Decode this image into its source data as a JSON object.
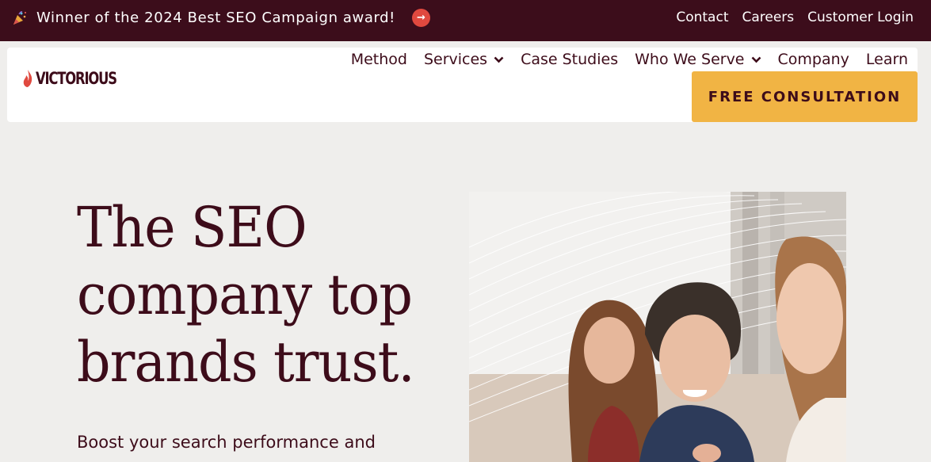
{
  "topbar": {
    "announcement": "Winner of the 2024 Best SEO Campaign award!",
    "links": [
      "Contact",
      "Careers",
      "Customer Login"
    ]
  },
  "header": {
    "logo_text": "VICTORIOUS",
    "nav": [
      {
        "label": "Method",
        "dropdown": false
      },
      {
        "label": "Services",
        "dropdown": true
      },
      {
        "label": "Case Studies",
        "dropdown": false
      },
      {
        "label": "Who We Serve",
        "dropdown": true
      },
      {
        "label": "Company",
        "dropdown": false
      },
      {
        "label": "Learn",
        "dropdown": false
      }
    ],
    "cta": "FREE CONSULTATION"
  },
  "hero": {
    "title_lines": [
      "The SEO",
      "company top",
      "brands trust."
    ],
    "subtitle": "Boost your search performance and"
  },
  "colors": {
    "topbar_bg": "#3c0d1b",
    "brand_text": "#3d0c1a",
    "cta_bg": "#f1b444",
    "accent_red": "#e0493f",
    "page_bg": "#efeeec"
  }
}
